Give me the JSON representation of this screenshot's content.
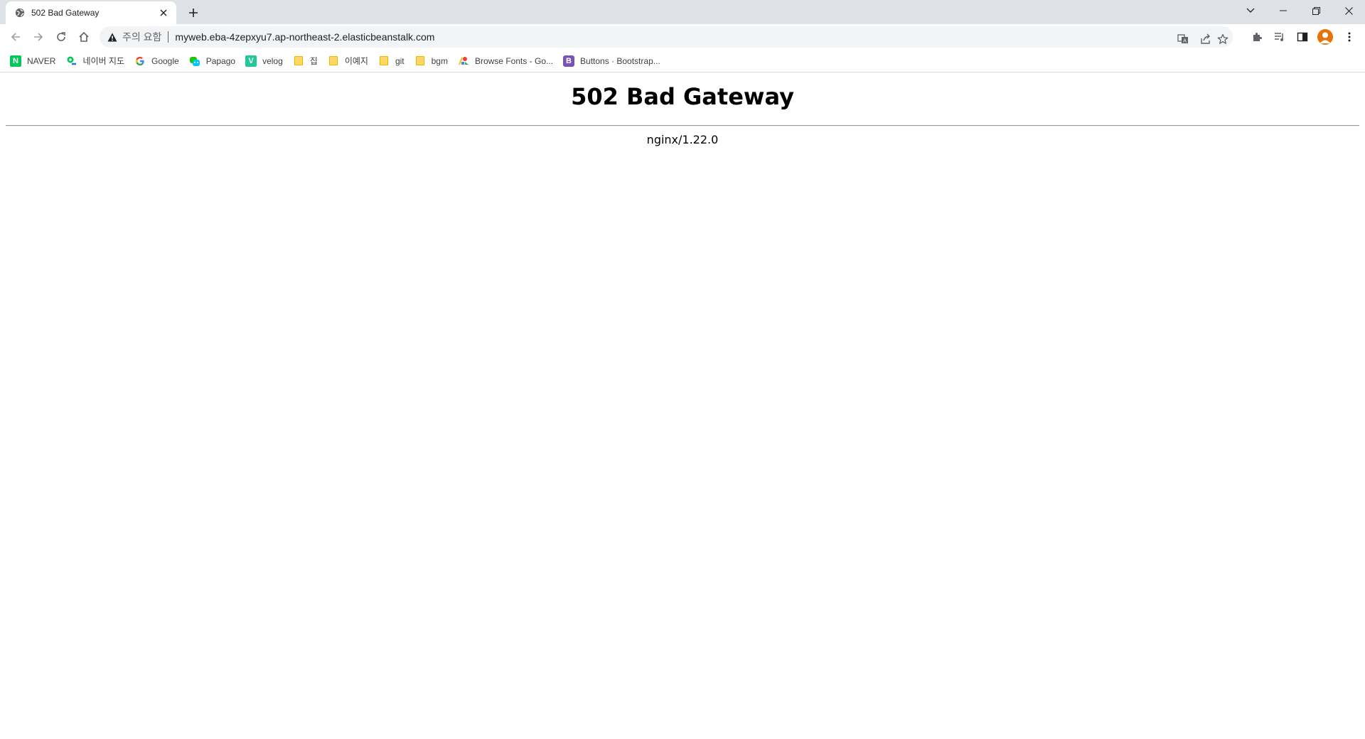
{
  "browser": {
    "tab": {
      "title": "502 Bad Gateway",
      "favicon": "globe-icon"
    },
    "window_controls": [
      "tab-search-icon",
      "minimize-icon",
      "restore-icon",
      "close-icon"
    ],
    "omnibox": {
      "security_label": "주의 요함",
      "url": "myweb.eba-4zepxyu7.ap-northeast-2.elasticbeanstalk.com"
    },
    "bookmarks": [
      {
        "label": "NAVER",
        "icon": "naver-icon",
        "color": "#03c75a"
      },
      {
        "label": "네이버 지도",
        "icon": "naver-map-icon",
        "color": "#03c75a"
      },
      {
        "label": "Google",
        "icon": "google-icon",
        "color": "#4285f4"
      },
      {
        "label": "Papago",
        "icon": "papago-icon",
        "color": "#1ec800"
      },
      {
        "label": "velog",
        "icon": "velog-icon",
        "color": "#20c997"
      },
      {
        "label": "집",
        "icon": "folder-icon",
        "color": "#fdd663"
      },
      {
        "label": "이예지",
        "icon": "folder-icon",
        "color": "#fdd663"
      },
      {
        "label": "git",
        "icon": "folder-icon",
        "color": "#fdd663"
      },
      {
        "label": "bgm",
        "icon": "folder-icon",
        "color": "#fdd663"
      },
      {
        "label": "Browse Fonts - Go...",
        "icon": "google-fonts-icon",
        "color": "#4285f4"
      },
      {
        "label": "Buttons · Bootstrap...",
        "icon": "bootstrap-icon",
        "color": "#7952b3"
      }
    ]
  },
  "page": {
    "heading": "502 Bad Gateway",
    "server": "nginx/1.22.0"
  },
  "colors": {
    "tabstrip_bg": "#dee1e6",
    "omnibox_bg": "#f1f3f4",
    "avatar": "#e8710a"
  }
}
